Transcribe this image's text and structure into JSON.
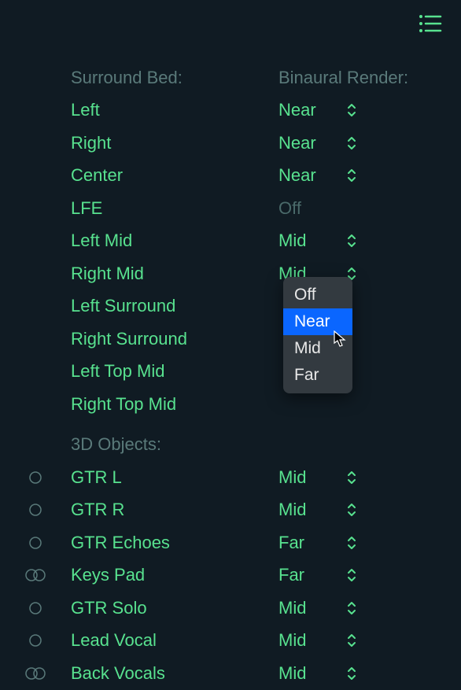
{
  "headers": {
    "surround_bed": "Surround Bed:",
    "binaural_render": "Binaural Render:",
    "objects_3d": "3D Objects:"
  },
  "surround_rows": [
    {
      "label": "Left",
      "value": "Near",
      "selector": true
    },
    {
      "label": "Right",
      "value": "Near",
      "selector": true
    },
    {
      "label": "Center",
      "value": "Near",
      "selector": true
    },
    {
      "label": "LFE",
      "value": "Off",
      "selector": false,
      "off": true
    },
    {
      "label": "Left Mid",
      "value": "Mid",
      "selector": true
    },
    {
      "label": "Right Mid",
      "value": "Mid",
      "selector": true
    },
    {
      "label": "Left Surround",
      "value": "",
      "selector": false
    },
    {
      "label": "Right Surround",
      "value": "",
      "selector": false
    },
    {
      "label": "Left Top Mid",
      "value": "",
      "selector": false
    },
    {
      "label": "Right Top Mid",
      "value": "",
      "selector": false
    }
  ],
  "object_rows": [
    {
      "label": "GTR L",
      "value": "Mid",
      "icon": "single"
    },
    {
      "label": "GTR R",
      "value": "Mid",
      "icon": "single"
    },
    {
      "label": "GTR Echoes",
      "value": "Far",
      "icon": "single"
    },
    {
      "label": "Keys Pad",
      "value": "Far",
      "icon": "double"
    },
    {
      "label": "GTR Solo",
      "value": "Mid",
      "icon": "single"
    },
    {
      "label": "Lead Vocal",
      "value": "Mid",
      "icon": "single"
    },
    {
      "label": "Back Vocals",
      "value": "Mid",
      "icon": "double"
    }
  ],
  "popup": {
    "items": [
      "Off",
      "Near",
      "Mid",
      "Far"
    ],
    "selected": "Near"
  }
}
